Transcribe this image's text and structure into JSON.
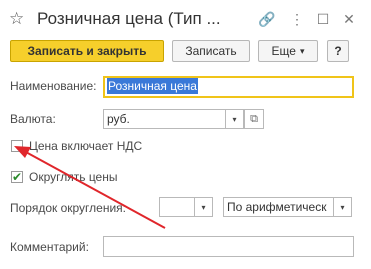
{
  "header": {
    "title": "Розничная цена (Тип ...",
    "star_icon": "☆",
    "link_icon": "🔗",
    "more_icon": "⋮",
    "maximize_icon": "☐",
    "close_icon": "✕"
  },
  "toolbar": {
    "save_close_label": "Записать и закрыть",
    "save_label": "Записать",
    "more_label": "Еще",
    "more_arrow": "▾",
    "help_label": "?"
  },
  "form": {
    "name": {
      "label": "Наименование:",
      "value": "Розничная цена"
    },
    "currency": {
      "label": "Валюта:",
      "value": "руб.",
      "dropdown": "▾",
      "open": "⧉"
    },
    "vat": {
      "label": "Цена включает НДС",
      "checked": false
    },
    "round": {
      "label": "Округлять цены",
      "checked": true,
      "mark": "✔"
    },
    "rounding_order": {
      "label": "Порядок округления:",
      "value": "",
      "dropdown": "▾"
    },
    "rounding_method": {
      "value": "По арифметическ",
      "dropdown": "▾"
    },
    "comment": {
      "label": "Комментарий:",
      "value": ""
    }
  },
  "annotation": {
    "arrow_color": "#e0262b"
  }
}
